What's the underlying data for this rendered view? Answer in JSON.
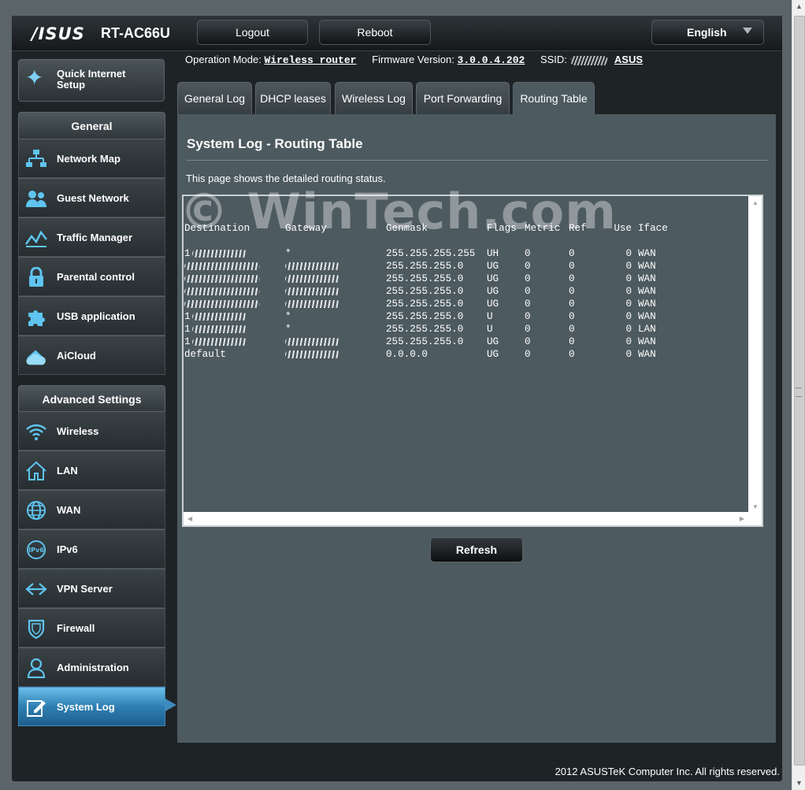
{
  "header": {
    "brand": "/ISUS",
    "model": "RT-AC66U",
    "logout_label": "Logout",
    "reboot_label": "Reboot",
    "language": "English"
  },
  "status_bar": {
    "op_mode_label": "Operation Mode:",
    "op_mode_value": "Wireless router",
    "firmware_label": "Firmware Version:",
    "firmware_value": "3.0.0.4.202",
    "ssid_label": "SSID:",
    "ssid_value": "ASUS"
  },
  "sidebar": {
    "qis_label": "Quick Internet Setup",
    "general_title": "General",
    "general_items": [
      {
        "label": "Network Map",
        "icon": "network-map-icon"
      },
      {
        "label": "Guest Network",
        "icon": "guest-network-icon"
      },
      {
        "label": "Traffic Manager",
        "icon": "traffic-manager-icon"
      },
      {
        "label": "Parental control",
        "icon": "lock-icon"
      },
      {
        "label": "USB application",
        "icon": "puzzle-icon"
      },
      {
        "label": "AiCloud",
        "icon": "cloud-icon"
      }
    ],
    "advanced_title": "Advanced Settings",
    "advanced_items": [
      {
        "label": "Wireless",
        "icon": "wifi-icon"
      },
      {
        "label": "LAN",
        "icon": "home-icon"
      },
      {
        "label": "WAN",
        "icon": "globe-icon"
      },
      {
        "label": "IPv6",
        "icon": "ipv6-icon"
      },
      {
        "label": "VPN Server",
        "icon": "vpn-icon"
      },
      {
        "label": "Firewall",
        "icon": "shield-icon"
      },
      {
        "label": "Administration",
        "icon": "user-icon"
      },
      {
        "label": "System Log",
        "icon": "edit-icon"
      }
    ],
    "active_item": "System Log"
  },
  "tabs": [
    {
      "label": "General Log"
    },
    {
      "label": "DHCP leases"
    },
    {
      "label": "Wireless Log"
    },
    {
      "label": "Port Forwarding"
    },
    {
      "label": "Routing Table"
    }
  ],
  "active_tab": "Routing Table",
  "main": {
    "title": "System Log - Routing Table",
    "description": "This page shows the detailed routing status.",
    "watermark": "© WinTech.com",
    "table": {
      "headers": [
        "Destination",
        "Gateway",
        "Genmask",
        "Flags",
        "Metric",
        "Ref",
        "Use",
        "Iface"
      ],
      "rows": [
        {
          "dst": "1",
          "gw": "*",
          "mask": "255.255.255.255",
          "flags": "UH",
          "metric": "0",
          "ref": "0",
          "use": "0",
          "iface": "WAN"
        },
        {
          "dst": "",
          "gw": "",
          "mask": "255.255.255.0",
          "flags": "UG",
          "metric": "0",
          "ref": "0",
          "use": "0",
          "iface": "WAN"
        },
        {
          "dst": "",
          "gw": "",
          "mask": "255.255.255.0",
          "flags": "UG",
          "metric": "0",
          "ref": "0",
          "use": "0",
          "iface": "WAN"
        },
        {
          "dst": "",
          "gw": "",
          "mask": "255.255.255.0",
          "flags": "UG",
          "metric": "0",
          "ref": "0",
          "use": "0",
          "iface": "WAN"
        },
        {
          "dst": "",
          "gw": "",
          "mask": "255.255.255.0",
          "flags": "UG",
          "metric": "0",
          "ref": "0",
          "use": "0",
          "iface": "WAN"
        },
        {
          "dst": "1",
          "gw": "*",
          "mask": "255.255.255.0",
          "flags": "U",
          "metric": "0",
          "ref": "0",
          "use": "0",
          "iface": "WAN"
        },
        {
          "dst": "1",
          "gw": "*",
          "mask": "255.255.255.0",
          "flags": "U",
          "metric": "0",
          "ref": "0",
          "use": "0",
          "iface": "LAN"
        },
        {
          "dst": "1",
          "gw": "",
          "mask": "255.255.255.0",
          "flags": "UG",
          "metric": "0",
          "ref": "0",
          "use": "0",
          "iface": "WAN"
        },
        {
          "dst": "default",
          "gw": "",
          "mask": "0.0.0.0",
          "flags": "UG",
          "metric": "0",
          "ref": "0",
          "use": "0",
          "iface": "WAN"
        }
      ]
    },
    "refresh_label": "Refresh"
  },
  "footer": "2012 ASUSTeK Computer Inc. All rights reserved."
}
